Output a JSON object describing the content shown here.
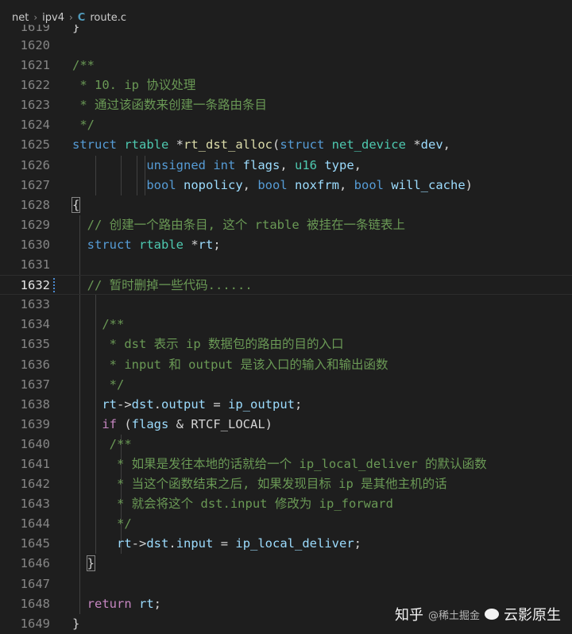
{
  "breadcrumb": {
    "segments": [
      "net",
      "ipv4"
    ],
    "file_icon": "C",
    "file": "route.c"
  },
  "code_lines": [
    {
      "ln": "1619",
      "tokens": [
        {
          "t": "}",
          "c": "plain"
        }
      ],
      "guides": [],
      "cut": true
    },
    {
      "ln": "1620",
      "tokens": [],
      "guides": []
    },
    {
      "ln": "1621",
      "tokens": [
        {
          "t": "/**",
          "c": "comment"
        }
      ],
      "guides": []
    },
    {
      "ln": "1622",
      "tokens": [
        {
          "t": " * 10. ip 协议处理",
          "c": "comment"
        }
      ],
      "guides": []
    },
    {
      "ln": "1623",
      "tokens": [
        {
          "t": " * 通过该函数来创建一条路由条目",
          "c": "comment"
        }
      ],
      "guides": []
    },
    {
      "ln": "1624",
      "tokens": [
        {
          "t": " */",
          "c": "comment"
        }
      ],
      "guides": []
    },
    {
      "ln": "1625",
      "tokens": [
        {
          "t": "struct ",
          "c": "keyword"
        },
        {
          "t": "rtable ",
          "c": "type"
        },
        {
          "t": "*",
          "c": "plain"
        },
        {
          "t": "rt_dst_alloc",
          "c": "func"
        },
        {
          "t": "(",
          "c": "plain"
        },
        {
          "t": "struct ",
          "c": "keyword"
        },
        {
          "t": "net_device ",
          "c": "type"
        },
        {
          "t": "*",
          "c": "plain"
        },
        {
          "t": "dev",
          "c": "param"
        },
        {
          "t": ",",
          "c": "plain"
        }
      ],
      "guides": []
    },
    {
      "ln": "1626",
      "tokens": [
        {
          "t": "          ",
          "c": "plain"
        },
        {
          "t": "unsigned ",
          "c": "keyword"
        },
        {
          "t": "int ",
          "c": "keyword"
        },
        {
          "t": "flags",
          "c": "param"
        },
        {
          "t": ", ",
          "c": "plain"
        },
        {
          "t": "u16 ",
          "c": "type"
        },
        {
          "t": "type",
          "c": "param"
        },
        {
          "t": ",",
          "c": "plain"
        }
      ],
      "guides": [
        1,
        2,
        3,
        4
      ]
    },
    {
      "ln": "1627",
      "tokens": [
        {
          "t": "          ",
          "c": "plain"
        },
        {
          "t": "bool ",
          "c": "keyword"
        },
        {
          "t": "nopolicy",
          "c": "param"
        },
        {
          "t": ", ",
          "c": "plain"
        },
        {
          "t": "bool ",
          "c": "keyword"
        },
        {
          "t": "noxfrm",
          "c": "param"
        },
        {
          "t": ", ",
          "c": "plain"
        },
        {
          "t": "bool ",
          "c": "keyword"
        },
        {
          "t": "will_cache",
          "c": "param"
        },
        {
          "t": ")",
          "c": "plain"
        }
      ],
      "guides": [
        1,
        2,
        3,
        4
      ]
    },
    {
      "ln": "1628",
      "tokens": [
        {
          "t": "{",
          "c": "plain"
        }
      ],
      "guides": [],
      "box": true
    },
    {
      "ln": "1629",
      "tokens": [
        {
          "t": "  ",
          "c": "plain"
        },
        {
          "t": "// 创建一个路由条目, 这个 rtable 被挂在一条链表上",
          "c": "comment"
        }
      ],
      "guides": [
        0
      ]
    },
    {
      "ln": "1630",
      "tokens": [
        {
          "t": "  ",
          "c": "plain"
        },
        {
          "t": "struct ",
          "c": "keyword"
        },
        {
          "t": "rtable ",
          "c": "type"
        },
        {
          "t": "*",
          "c": "plain"
        },
        {
          "t": "rt",
          "c": "param"
        },
        {
          "t": ";",
          "c": "plain"
        }
      ],
      "guides": [
        0
      ]
    },
    {
      "ln": "1631",
      "tokens": [],
      "guides": [
        0
      ]
    },
    {
      "ln": "1632",
      "tokens": [
        {
          "t": "  ",
          "c": "plain"
        },
        {
          "t": "// 暂时删掉一些代码......",
          "c": "comment"
        }
      ],
      "guides": [
        0
      ],
      "current": true,
      "diff": true
    },
    {
      "ln": "1633",
      "tokens": [],
      "guides": [
        0,
        1
      ]
    },
    {
      "ln": "1634",
      "tokens": [
        {
          "t": "    ",
          "c": "plain"
        },
        {
          "t": "/**",
          "c": "comment"
        }
      ],
      "guides": [
        0,
        1
      ]
    },
    {
      "ln": "1635",
      "tokens": [
        {
          "t": "    ",
          "c": "plain"
        },
        {
          "t": " * dst 表示 ip 数据包的路由的目的入口",
          "c": "comment"
        }
      ],
      "guides": [
        0,
        1
      ]
    },
    {
      "ln": "1636",
      "tokens": [
        {
          "t": "    ",
          "c": "plain"
        },
        {
          "t": " * input 和 output 是该入口的输入和输出函数",
          "c": "comment"
        }
      ],
      "guides": [
        0,
        1
      ]
    },
    {
      "ln": "1637",
      "tokens": [
        {
          "t": "    ",
          "c": "plain"
        },
        {
          "t": " */",
          "c": "comment"
        }
      ],
      "guides": [
        0,
        1
      ]
    },
    {
      "ln": "1638",
      "tokens": [
        {
          "t": "    ",
          "c": "plain"
        },
        {
          "t": "rt",
          "c": "param"
        },
        {
          "t": "->",
          "c": "plain"
        },
        {
          "t": "dst",
          "c": "param"
        },
        {
          "t": ".",
          "c": "plain"
        },
        {
          "t": "output",
          "c": "param"
        },
        {
          "t": " = ",
          "c": "plain"
        },
        {
          "t": "ip_output",
          "c": "param"
        },
        {
          "t": ";",
          "c": "plain"
        }
      ],
      "guides": [
        0,
        1
      ]
    },
    {
      "ln": "1639",
      "tokens": [
        {
          "t": "    ",
          "c": "plain"
        },
        {
          "t": "if ",
          "c": "ctrl"
        },
        {
          "t": "(",
          "c": "plain"
        },
        {
          "t": "flags",
          "c": "param"
        },
        {
          "t": " & ",
          "c": "plain"
        },
        {
          "t": "RTCF_LOCAL",
          "c": "plain"
        },
        {
          "t": ")",
          "c": "plain"
        }
      ],
      "guides": [
        0,
        1
      ]
    },
    {
      "ln": "1640",
      "tokens": [
        {
          "t": "     ",
          "c": "plain"
        },
        {
          "t": "/**",
          "c": "comment"
        }
      ],
      "guides": [
        0,
        1,
        2
      ]
    },
    {
      "ln": "1641",
      "tokens": [
        {
          "t": "     ",
          "c": "plain"
        },
        {
          "t": " * 如果是发往本地的话就给一个 ip_local_deliver 的默认函数",
          "c": "comment"
        }
      ],
      "guides": [
        0,
        1,
        2
      ]
    },
    {
      "ln": "1642",
      "tokens": [
        {
          "t": "     ",
          "c": "plain"
        },
        {
          "t": " * 当这个函数结束之后, 如果发现目标 ip 是其他主机的话",
          "c": "comment"
        }
      ],
      "guides": [
        0,
        1,
        2
      ]
    },
    {
      "ln": "1643",
      "tokens": [
        {
          "t": "     ",
          "c": "plain"
        },
        {
          "t": " * 就会将这个 dst.input 修改为 ip_forward",
          "c": "comment"
        }
      ],
      "guides": [
        0,
        1,
        2
      ]
    },
    {
      "ln": "1644",
      "tokens": [
        {
          "t": "     ",
          "c": "plain"
        },
        {
          "t": " */",
          "c": "comment"
        }
      ],
      "guides": [
        0,
        1,
        2
      ]
    },
    {
      "ln": "1645",
      "tokens": [
        {
          "t": "      ",
          "c": "plain"
        },
        {
          "t": "rt",
          "c": "param"
        },
        {
          "t": "->",
          "c": "plain"
        },
        {
          "t": "dst",
          "c": "param"
        },
        {
          "t": ".",
          "c": "plain"
        },
        {
          "t": "input",
          "c": "param"
        },
        {
          "t": " = ",
          "c": "plain"
        },
        {
          "t": "ip_local_deliver",
          "c": "param"
        },
        {
          "t": ";",
          "c": "plain"
        }
      ],
      "guides": [
        0,
        1,
        2
      ]
    },
    {
      "ln": "1646",
      "tokens": [
        {
          "t": "  ",
          "c": "plain"
        },
        {
          "t": "}",
          "c": "plain"
        }
      ],
      "guides": [
        0
      ],
      "box": true
    },
    {
      "ln": "1647",
      "tokens": [],
      "guides": [
        0
      ]
    },
    {
      "ln": "1648",
      "tokens": [
        {
          "t": "  ",
          "c": "plain"
        },
        {
          "t": "return ",
          "c": "ctrl"
        },
        {
          "t": "rt",
          "c": "param"
        },
        {
          "t": ";",
          "c": "plain"
        }
      ],
      "guides": [
        0
      ]
    },
    {
      "ln": "1649",
      "tokens": [
        {
          "t": "}",
          "c": "plain"
        }
      ],
      "guides": []
    }
  ],
  "watermark": {
    "zhihu": "知乎",
    "faint": "@稀土掘金",
    "brand": "云影原生"
  }
}
